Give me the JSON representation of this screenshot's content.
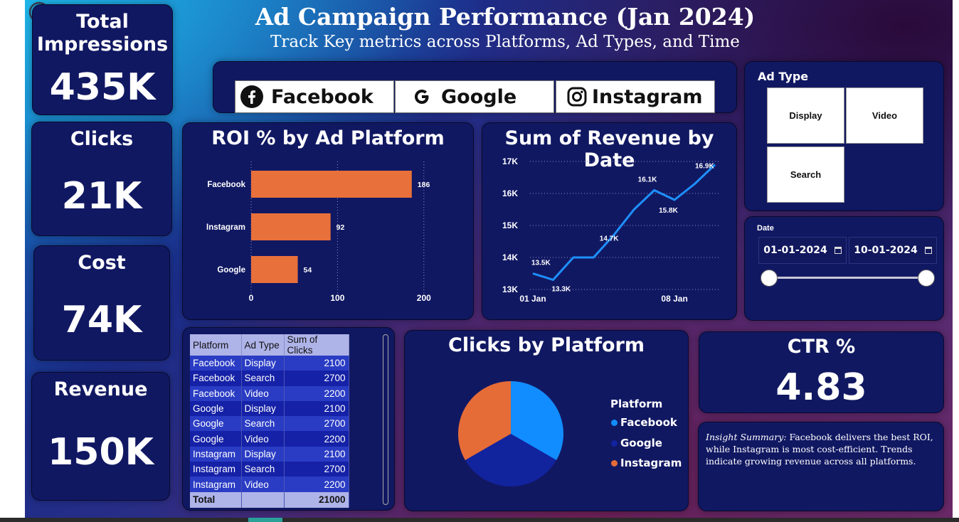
{
  "header": {
    "title": "Ad Campaign Performance (Jan 2024)",
    "subtitle": "Track Key metrics across Platforms, Ad Types, and Time"
  },
  "kpis": {
    "impressions": {
      "label": "Total Impressions",
      "value": "435K"
    },
    "clicks": {
      "label": "Clicks",
      "value": "21K"
    },
    "cost": {
      "label": "Cost",
      "value": "74K"
    },
    "revenue": {
      "label": "Revenue",
      "value": "150K"
    },
    "ctr": {
      "label": "CTR %",
      "value": "4.83"
    }
  },
  "platform_slicer": {
    "items": [
      {
        "label": "Facebook",
        "icon": "facebook-icon"
      },
      {
        "label": "Google",
        "icon": "google-icon"
      },
      {
        "label": "Instagram",
        "icon": "instagram-icon"
      }
    ]
  },
  "ad_type_slicer": {
    "title": "Ad Type",
    "items": [
      "Display",
      "Video",
      "Search"
    ]
  },
  "date_slicer": {
    "label": "Date",
    "start": "01-01-2024",
    "end": "10-01-2024"
  },
  "roi_chart": {
    "title": "ROI % by Ad Platform",
    "chart_data": {
      "type": "bar",
      "orientation": "horizontal",
      "categories": [
        "Facebook",
        "Instagram",
        "Google"
      ],
      "values": [
        186,
        92,
        54
      ],
      "data_labels": [
        "186",
        "92",
        "54"
      ],
      "xticks": [
        "0",
        "100",
        "200"
      ],
      "xlim": [
        0,
        215
      ],
      "color": "#e8703a"
    }
  },
  "revenue_chart": {
    "title": "Sum of Revenue by Date",
    "chart_data": {
      "type": "line",
      "x": [
        "2024-01-01",
        "2024-01-02",
        "2024-01-03",
        "2024-01-04",
        "2024-01-05",
        "2024-01-06",
        "2024-01-07",
        "2024-01-08",
        "2024-01-09",
        "2024-01-10"
      ],
      "values": [
        13500,
        13300,
        14000,
        14000,
        14700,
        15500,
        16100,
        15800,
        16300,
        16900
      ],
      "point_labels": [
        "13.5K",
        "13.3K",
        "",
        "",
        "14.7K",
        "",
        "16.1K",
        "15.8K",
        "",
        "16.9K"
      ],
      "yticks": [
        "13K",
        "14K",
        "15K",
        "16K",
        "17K"
      ],
      "ylim": [
        13000,
        17000
      ],
      "xtick_labels": [
        "01 Jan",
        "08 Jan"
      ],
      "color": "#1e90ff"
    }
  },
  "clicks_table": {
    "columns": [
      "Platform",
      "Ad Type",
      "Sum of Clicks"
    ],
    "rows": [
      [
        "Facebook",
        "Display",
        "2100"
      ],
      [
        "Facebook",
        "Search",
        "2700"
      ],
      [
        "Facebook",
        "Video",
        "2200"
      ],
      [
        "Google",
        "Display",
        "2100"
      ],
      [
        "Google",
        "Search",
        "2700"
      ],
      [
        "Google",
        "Video",
        "2200"
      ],
      [
        "Instagram",
        "Display",
        "2100"
      ],
      [
        "Instagram",
        "Search",
        "2700"
      ],
      [
        "Instagram",
        "Video",
        "2200"
      ]
    ],
    "total": [
      "Total",
      "",
      "21000"
    ]
  },
  "clicks_pie": {
    "title": "Clicks by Platform",
    "legend_title": "Platform",
    "chart_data": {
      "type": "pie",
      "categories": [
        "Facebook",
        "Google",
        "Instagram"
      ],
      "values": [
        7000,
        7000,
        7000
      ],
      "colors": [
        "#118dff",
        "#12239e",
        "#e66c37"
      ]
    }
  },
  "insight": {
    "label": "Insight Summary:",
    "text": " Facebook delivers the best ROI, while Instagram is most cost-efficient. Trends indicate growing revenue across all platforms."
  }
}
